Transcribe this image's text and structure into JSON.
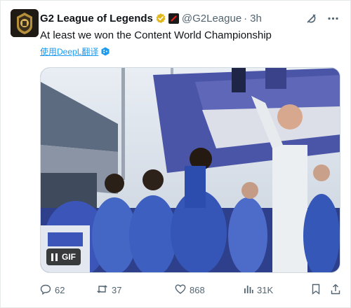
{
  "account": {
    "name": "G2 League of Legends",
    "handle": "@G2League",
    "separator": "·",
    "time": "3h"
  },
  "tweet": {
    "text": "At least we won the Content World Championship",
    "translate_label": "使用DeepL翻译"
  },
  "media": {
    "badge_label": "GIF"
  },
  "stats": {
    "replies": "62",
    "reposts": "37",
    "likes": "868",
    "views": "31K"
  },
  "icons": {
    "verified": "verified-badge-icon",
    "affiliate": "affiliate-icon",
    "grok": "grok-icon",
    "more": "more-icon",
    "reply": "reply-icon",
    "repost": "repost-icon",
    "like": "heart-icon",
    "views": "views-icon",
    "bookmark": "bookmark-icon",
    "share": "share-icon"
  },
  "colors": {
    "accent": "#1d9bf0",
    "muted": "#536471",
    "verified_gold": "#e2b719"
  }
}
